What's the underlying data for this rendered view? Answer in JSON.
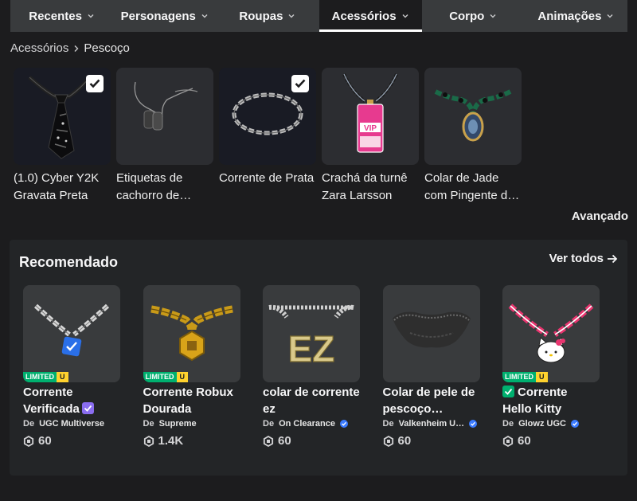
{
  "tabs": [
    {
      "label": "Recentes",
      "active": false
    },
    {
      "label": "Personagens",
      "active": false
    },
    {
      "label": "Roupas",
      "active": false
    },
    {
      "label": "Acessórios",
      "active": true
    },
    {
      "label": "Corpo",
      "active": false
    },
    {
      "label": "Animações",
      "active": false
    }
  ],
  "breadcrumb": {
    "parent": "Acessórios",
    "current": "Pescoço"
  },
  "owned_items": [
    {
      "title": "(1.0) Cyber Y2K Gravata Preta",
      "checked": true,
      "icon": "black-tie-icon"
    },
    {
      "title": "Etiquetas de cachorro de aço…",
      "checked": false,
      "icon": "dog-tags-icon"
    },
    {
      "title": "Corrente de Prata",
      "checked": true,
      "icon": "silver-chain-icon"
    },
    {
      "title": "Crachá da turnê Zara Larsson",
      "checked": false,
      "icon": "vip-badge-icon"
    },
    {
      "title": "Colar de Jade com Pingente d…",
      "checked": false,
      "icon": "jade-necklace-icon"
    }
  ],
  "advanced_label": "Avançado",
  "recommended": {
    "title": "Recomendado",
    "see_all": "Ver todos",
    "items": [
      {
        "name": "Corrente Verificada",
        "limited": true,
        "limited_label": "LIMITED",
        "limited_u": "U",
        "by_prefix": "De",
        "creator": "UGC Multiverse",
        "creator_verified": false,
        "price": "60",
        "icon": "verified-chain-icon"
      },
      {
        "name": "Corrente Robux Dourada",
        "limited": true,
        "limited_label": "LIMITED",
        "limited_u": "U",
        "by_prefix": "De",
        "creator": "Supreme",
        "creator_verified": false,
        "price": "1.4K",
        "icon": "gold-robux-chain-icon"
      },
      {
        "name": "colar de corrente ez",
        "limited": false,
        "by_prefix": "De",
        "creator": "On Clearance",
        "creator_verified": true,
        "price": "60",
        "icon": "ez-chain-icon"
      },
      {
        "name": "Colar de pele de pescoço…",
        "limited": false,
        "by_prefix": "De",
        "creator": "Valkenheim U…",
        "creator_verified": true,
        "price": "60",
        "icon": "fur-collar-icon"
      },
      {
        "name": "Corrente Hello Kitty",
        "limited": true,
        "limited_label": "LIMITED",
        "limited_u": "U",
        "by_prefix": "De",
        "creator": "Glowz UGC",
        "creator_verified": true,
        "price": "60",
        "icon": "hello-kitty-chain-icon"
      }
    ]
  },
  "colors": {
    "background": "#1c1c1e",
    "tabbar": "#393b3d",
    "panel": "#232527",
    "limited_green": "#00b06f",
    "limited_yellow": "#ffd22e",
    "verified_blue": "#3b7bff"
  }
}
